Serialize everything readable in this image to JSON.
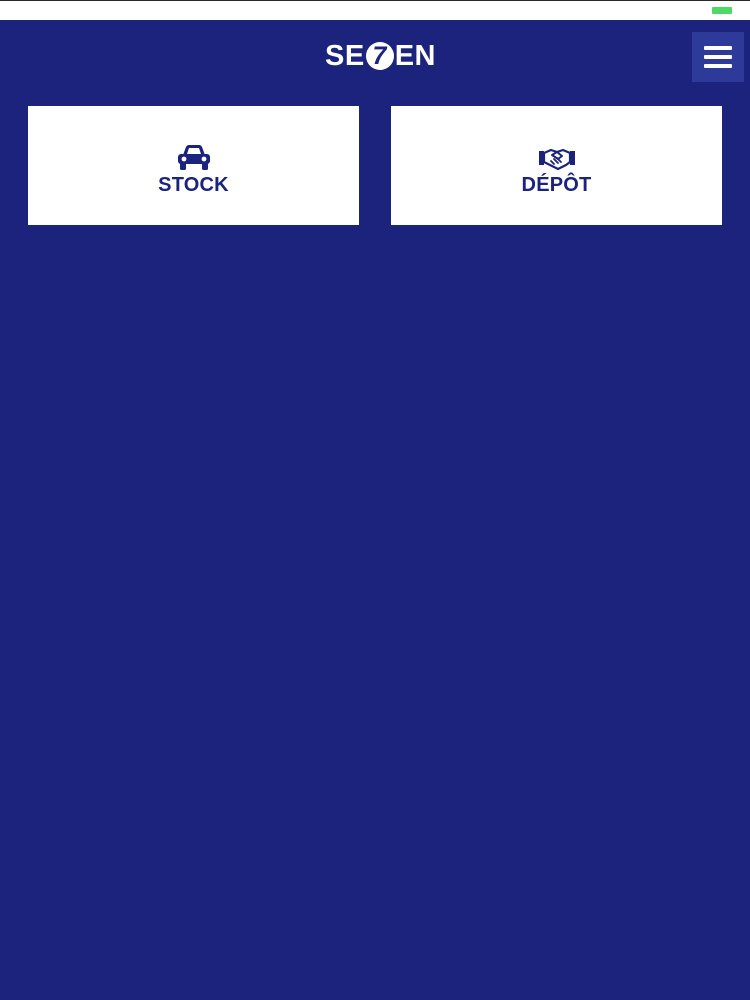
{
  "logo": {
    "part1": "SE",
    "seven": "7",
    "part2": "EN"
  },
  "menu": {
    "icon": "hamburger-menu-icon"
  },
  "tiles": [
    {
      "label": "STOCK",
      "icon": "car-icon"
    },
    {
      "label": "DÉPÔT",
      "icon": "handshake-icon"
    }
  ],
  "colors": {
    "background": "#1b237c",
    "tile": "#ffffff",
    "accent": "#1b237c",
    "menu_button": "#2d3a9a",
    "battery": "#4cd964"
  }
}
